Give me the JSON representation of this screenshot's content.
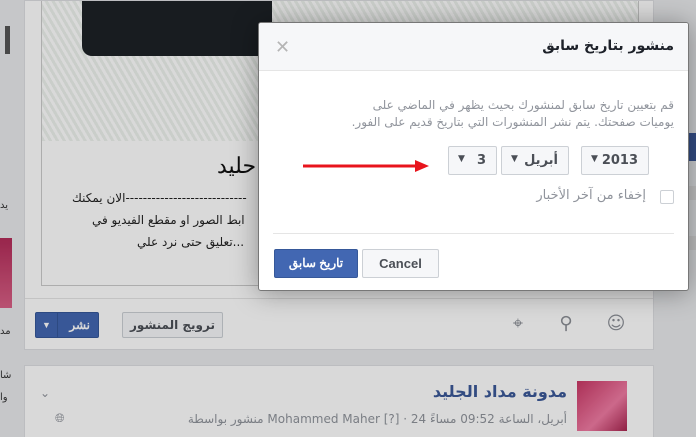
{
  "composer": {
    "preview_title": "حليد",
    "preview_lines": [
      "الان يمكنك----------------------------",
      "ابط الصور او مقطع الفيديو في",
      "تعليق حتى نرد علي..."
    ],
    "promote_label": "ترويج المنشور",
    "publish_label": "نشر"
  },
  "post2": {
    "page_name": "مدونة مداد الجليد",
    "subline": "منشور بواسطة Mohammed Maher [?] · 24 أبريل، الساعة 09:52 مساءً"
  },
  "left_fragments": [
    "يد",
    "مد",
    "شا",
    "وا"
  ],
  "dialog": {
    "title": "منشور بتاريخ سابق",
    "description": "قم بتعيين تاريخ سابق لمنشورك بحيث يظهر في الماضي على يوميات صفحتك. يتم نشر المنشورات التي بتاريخ قديم على الفور.",
    "year": "2013",
    "month": "أبريل",
    "day": "3",
    "hide_label": "إخفاء من آخر الأخبار",
    "backdate_label": "تاريخ سابق",
    "cancel_label": "Cancel"
  },
  "colors": {
    "facebook_blue": "#4267b2",
    "arrow_red": "#e8141c"
  },
  "icons": [
    "close-icon",
    "chevron-down-icon",
    "smiley-icon",
    "location-icon",
    "target-icon",
    "globe-icon"
  ]
}
